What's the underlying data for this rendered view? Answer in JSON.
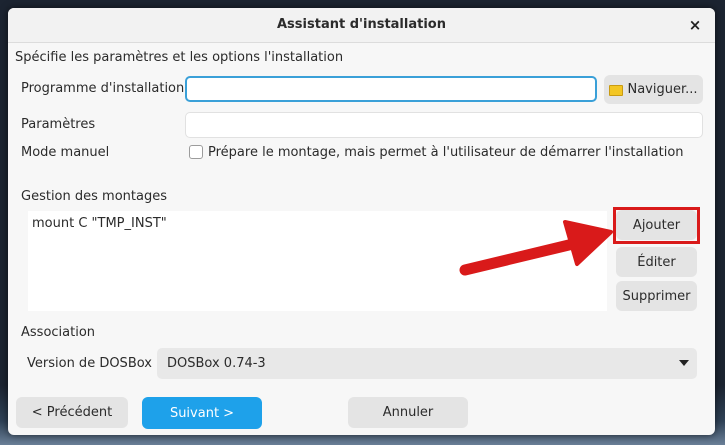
{
  "dialog": {
    "title": "Assistant d'installation",
    "close_glyph": "×",
    "subtitle": "Spécifie les paramètres et les options l'installation"
  },
  "form": {
    "installer_label": "Programme d'installation",
    "installer_value": "",
    "browse_label": "Naviguer...",
    "parameters_label": "Paramètres",
    "parameters_value": "",
    "manual_mode_label": "Mode manuel",
    "manual_mode_checked": false,
    "manual_mode_text": "Prépare le montage, mais permet à l'utilisateur de démarrer l'installation"
  },
  "mounts": {
    "section_label": "Gestion des montages",
    "items": [
      "mount C \"TMP_INST\""
    ],
    "add_label": "Ajouter",
    "edit_label": "Éditer",
    "delete_label": "Supprimer"
  },
  "association": {
    "section_label": "Association",
    "dosbox_label": "Version de DOSBox",
    "dosbox_selected": "DOSBox 0.74-3"
  },
  "footer": {
    "previous_label": "< Précédent",
    "next_label": "Suivant >",
    "cancel_label": "Annuler"
  },
  "colors": {
    "accent": "#1ea1ea",
    "focus_border": "#3aa0d8",
    "annotation_red": "#d91a1a"
  },
  "icons": [
    "close-icon",
    "folder-icon",
    "dropdown-arrow-icon",
    "annotation-arrow-icon"
  ]
}
